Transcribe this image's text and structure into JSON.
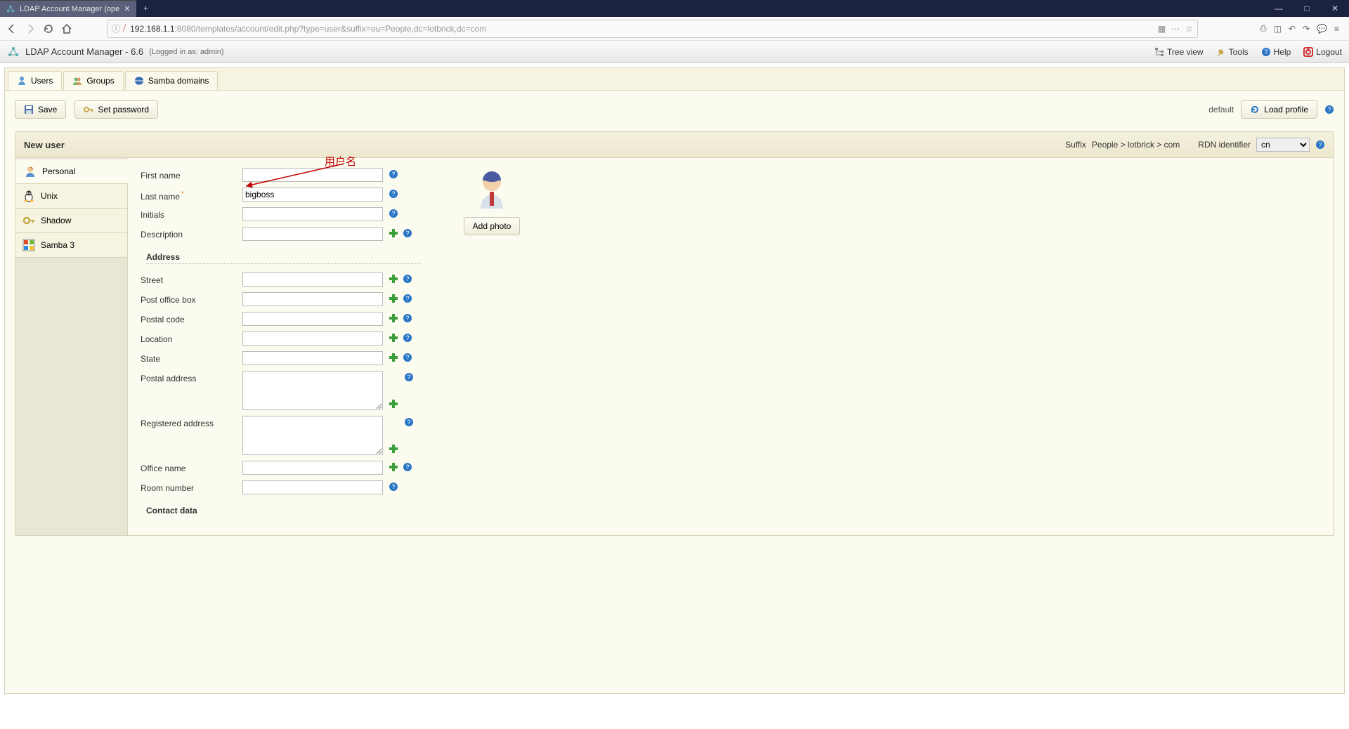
{
  "browser": {
    "tab_title": "LDAP Account Manager (ope",
    "url_display_prefix": "192.168.1.1",
    "url_display_port": ":8080",
    "url_display_path": "/templates/account/edit.php?type=user&suffix=ou=People,dc=lotbrick,dc=com"
  },
  "header": {
    "app_title": "LDAP Account Manager - 6.6",
    "login_info": "(Logged in as: admin)",
    "links": {
      "tree": "Tree view",
      "tools": "Tools",
      "help": "Help",
      "logout": "Logout"
    }
  },
  "outer_tabs": {
    "users": "Users",
    "groups": "Groups",
    "samba_domains": "Samba domains"
  },
  "actions": {
    "save": "Save",
    "set_password": "Set password",
    "default_label": "default",
    "load_profile": "Load profile"
  },
  "panel": {
    "title": "New user",
    "suffix_label": "Suffix",
    "suffix_value": "People > lotbrick > com",
    "rdn_label": "RDN identifier",
    "rdn_selected": "cn"
  },
  "side_tabs": {
    "personal": "Personal",
    "unix": "Unix",
    "shadow": "Shadow",
    "samba": "Samba 3"
  },
  "form": {
    "first_name": {
      "label": "First name",
      "value": ""
    },
    "last_name": {
      "label": "Last name",
      "value": "bigboss"
    },
    "initials": {
      "label": "Initials",
      "value": ""
    },
    "description": {
      "label": "Description",
      "value": ""
    },
    "address_header": "Address",
    "street": {
      "label": "Street",
      "value": ""
    },
    "po_box": {
      "label": "Post office box",
      "value": ""
    },
    "postal_code": {
      "label": "Postal code",
      "value": ""
    },
    "location": {
      "label": "Location",
      "value": ""
    },
    "state": {
      "label": "State",
      "value": ""
    },
    "postal_address": {
      "label": "Postal address",
      "value": ""
    },
    "registered_address": {
      "label": "Registered address",
      "value": ""
    },
    "office_name": {
      "label": "Office name",
      "value": ""
    },
    "room_number": {
      "label": "Room number",
      "value": ""
    },
    "contact_header": "Contact data"
  },
  "photo": {
    "add_photo": "Add photo"
  },
  "annotation": {
    "text": "用户名"
  }
}
